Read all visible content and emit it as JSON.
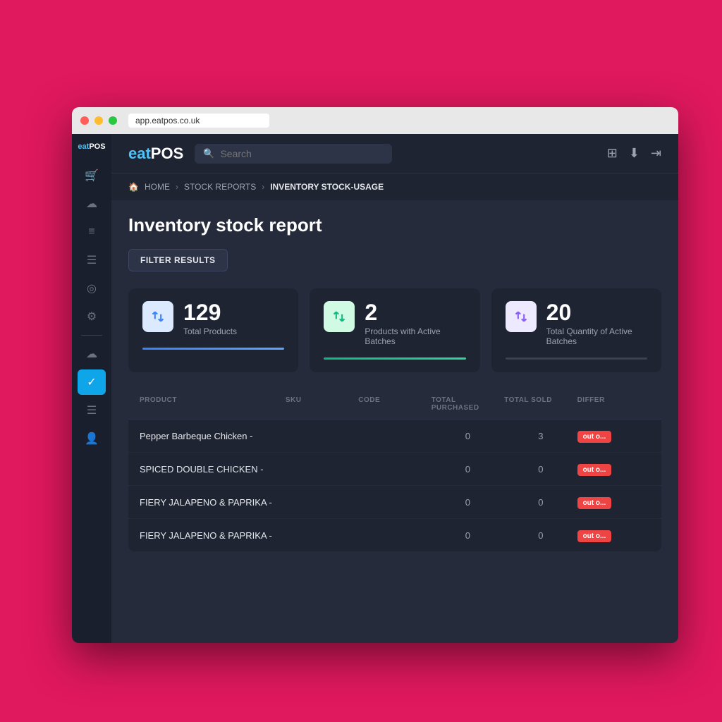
{
  "browser": {
    "url": "app.eatpos.co.uk"
  },
  "sidebar": {
    "logo_eat": "eat",
    "logo_pos": "POS",
    "icons": [
      {
        "name": "cart-icon",
        "symbol": "🛒",
        "active": false
      },
      {
        "name": "cloud-icon",
        "symbol": "☁",
        "active": false
      },
      {
        "name": "menu-icon",
        "symbol": "≡",
        "active": false
      },
      {
        "name": "list-icon",
        "symbol": "☰",
        "active": false
      },
      {
        "name": "circle-icon",
        "symbol": "◎",
        "active": false
      },
      {
        "name": "gear-icon",
        "symbol": "⚙",
        "active": false
      },
      {
        "name": "cloud2-icon",
        "symbol": "☁",
        "active": false
      },
      {
        "name": "check-circle-icon",
        "symbol": "✓",
        "active": true
      },
      {
        "name": "list2-icon",
        "symbol": "☰",
        "active": false
      },
      {
        "name": "user-icon",
        "symbol": "👤",
        "active": false
      }
    ]
  },
  "header": {
    "brand_eat": "eat",
    "brand_pos": "POS",
    "search_placeholder": "Search"
  },
  "breadcrumb": {
    "home": "HOME",
    "stock_reports": "STOCK REPORTS",
    "current": "INVENTORY STOCK-USAGE"
  },
  "page": {
    "title": "Inventory stock report",
    "filter_btn": "FILTER RESULTS"
  },
  "stats": [
    {
      "number": "129",
      "label": "Total Products",
      "bar_class": "bar-blue",
      "icon_class": "stat-icon-blue"
    },
    {
      "number": "2",
      "label": "Products with Active Batches",
      "bar_class": "bar-green",
      "icon_class": "stat-icon-green"
    },
    {
      "number": "20",
      "label": "Total Quantity of Active Batches",
      "bar_class": "bar-gray",
      "icon_class": "stat-icon-purple"
    }
  ],
  "table": {
    "headers": [
      "PRODUCT",
      "SKU",
      "CODE",
      "TOTAL PURCHASED",
      "TOTAL SOLD",
      "DIFFER"
    ],
    "rows": [
      {
        "product": "Pepper Barbeque Chicken -",
        "sku": "",
        "code": "",
        "total_purchased": "0",
        "total_sold": "3",
        "status": "out o..."
      },
      {
        "product": "SPICED DOUBLE CHICKEN -",
        "sku": "",
        "code": "",
        "total_purchased": "0",
        "total_sold": "0",
        "status": "out o..."
      },
      {
        "product": "FIERY JALAPENO & PAPRIKA -",
        "sku": "",
        "code": "",
        "total_purchased": "0",
        "total_sold": "0",
        "status": "out o..."
      },
      {
        "product": "FIERY JALAPENO & PAPRIKA -",
        "sku": "",
        "code": "",
        "total_purchased": "0",
        "total_sold": "0",
        "status": "out o..."
      }
    ]
  }
}
